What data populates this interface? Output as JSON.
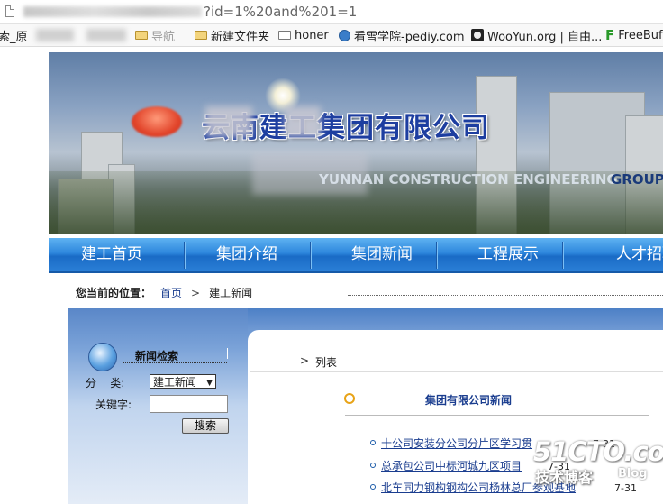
{
  "browser": {
    "url_visible": "?id=1%20and%201=1"
  },
  "bookmarks": [
    {
      "label": "索_原",
      "icon": "text"
    },
    {
      "label": "导航",
      "icon": "folder"
    },
    {
      "label": "新建文件夹",
      "icon": "folder"
    },
    {
      "label": "honer",
      "icon": "folder-outline"
    },
    {
      "label": "看雪学院-pediy.com",
      "icon": "globe-icon"
    },
    {
      "label": "WooYun.org | 自由...",
      "icon": "wooyun-icon"
    },
    {
      "label": "FreeBuf",
      "icon": "freebuf-logo"
    }
  ],
  "banner": {
    "company_name": "云南建工集团有限公司",
    "company_en": "YUNNAN CONSTRUCTION ENGINEERING",
    "company_en_tail": "GROUP"
  },
  "nav": {
    "items": [
      "建工首页",
      "集团介绍",
      "集团新闻",
      "工程展示",
      "人才招聘"
    ]
  },
  "breadcrumb": {
    "label": "您当前的位置：",
    "home": "首页",
    "separator": ">",
    "current": "建工新闻"
  },
  "search": {
    "title": "新闻检索",
    "category_label": "分    类:",
    "category_value": "建工新闻",
    "keyword_label": "关键字:",
    "keyword_value": "",
    "button": "搜索"
  },
  "list": {
    "arrow": ">",
    "label": "列表",
    "section_title": "集团有限公司新闻",
    "items": [
      {
        "title": "十公司安装分公司分片区学习贯",
        "date": "7-31"
      },
      {
        "title": "总承包公司中标河城九区项目",
        "date": "7-31"
      },
      {
        "title": "北车同力钢构钢构公司杨林总厂参观基地",
        "date": "7-31"
      }
    ]
  },
  "watermark": {
    "brand": "51CTO.com",
    "sub": "技术博客",
    "blog": "Blog"
  },
  "colors": {
    "nav_blue": "#2d86dc",
    "link_blue": "#1a3d8f",
    "panel_blue": "#5a87c8",
    "bullet_orange": "#e8a317"
  }
}
